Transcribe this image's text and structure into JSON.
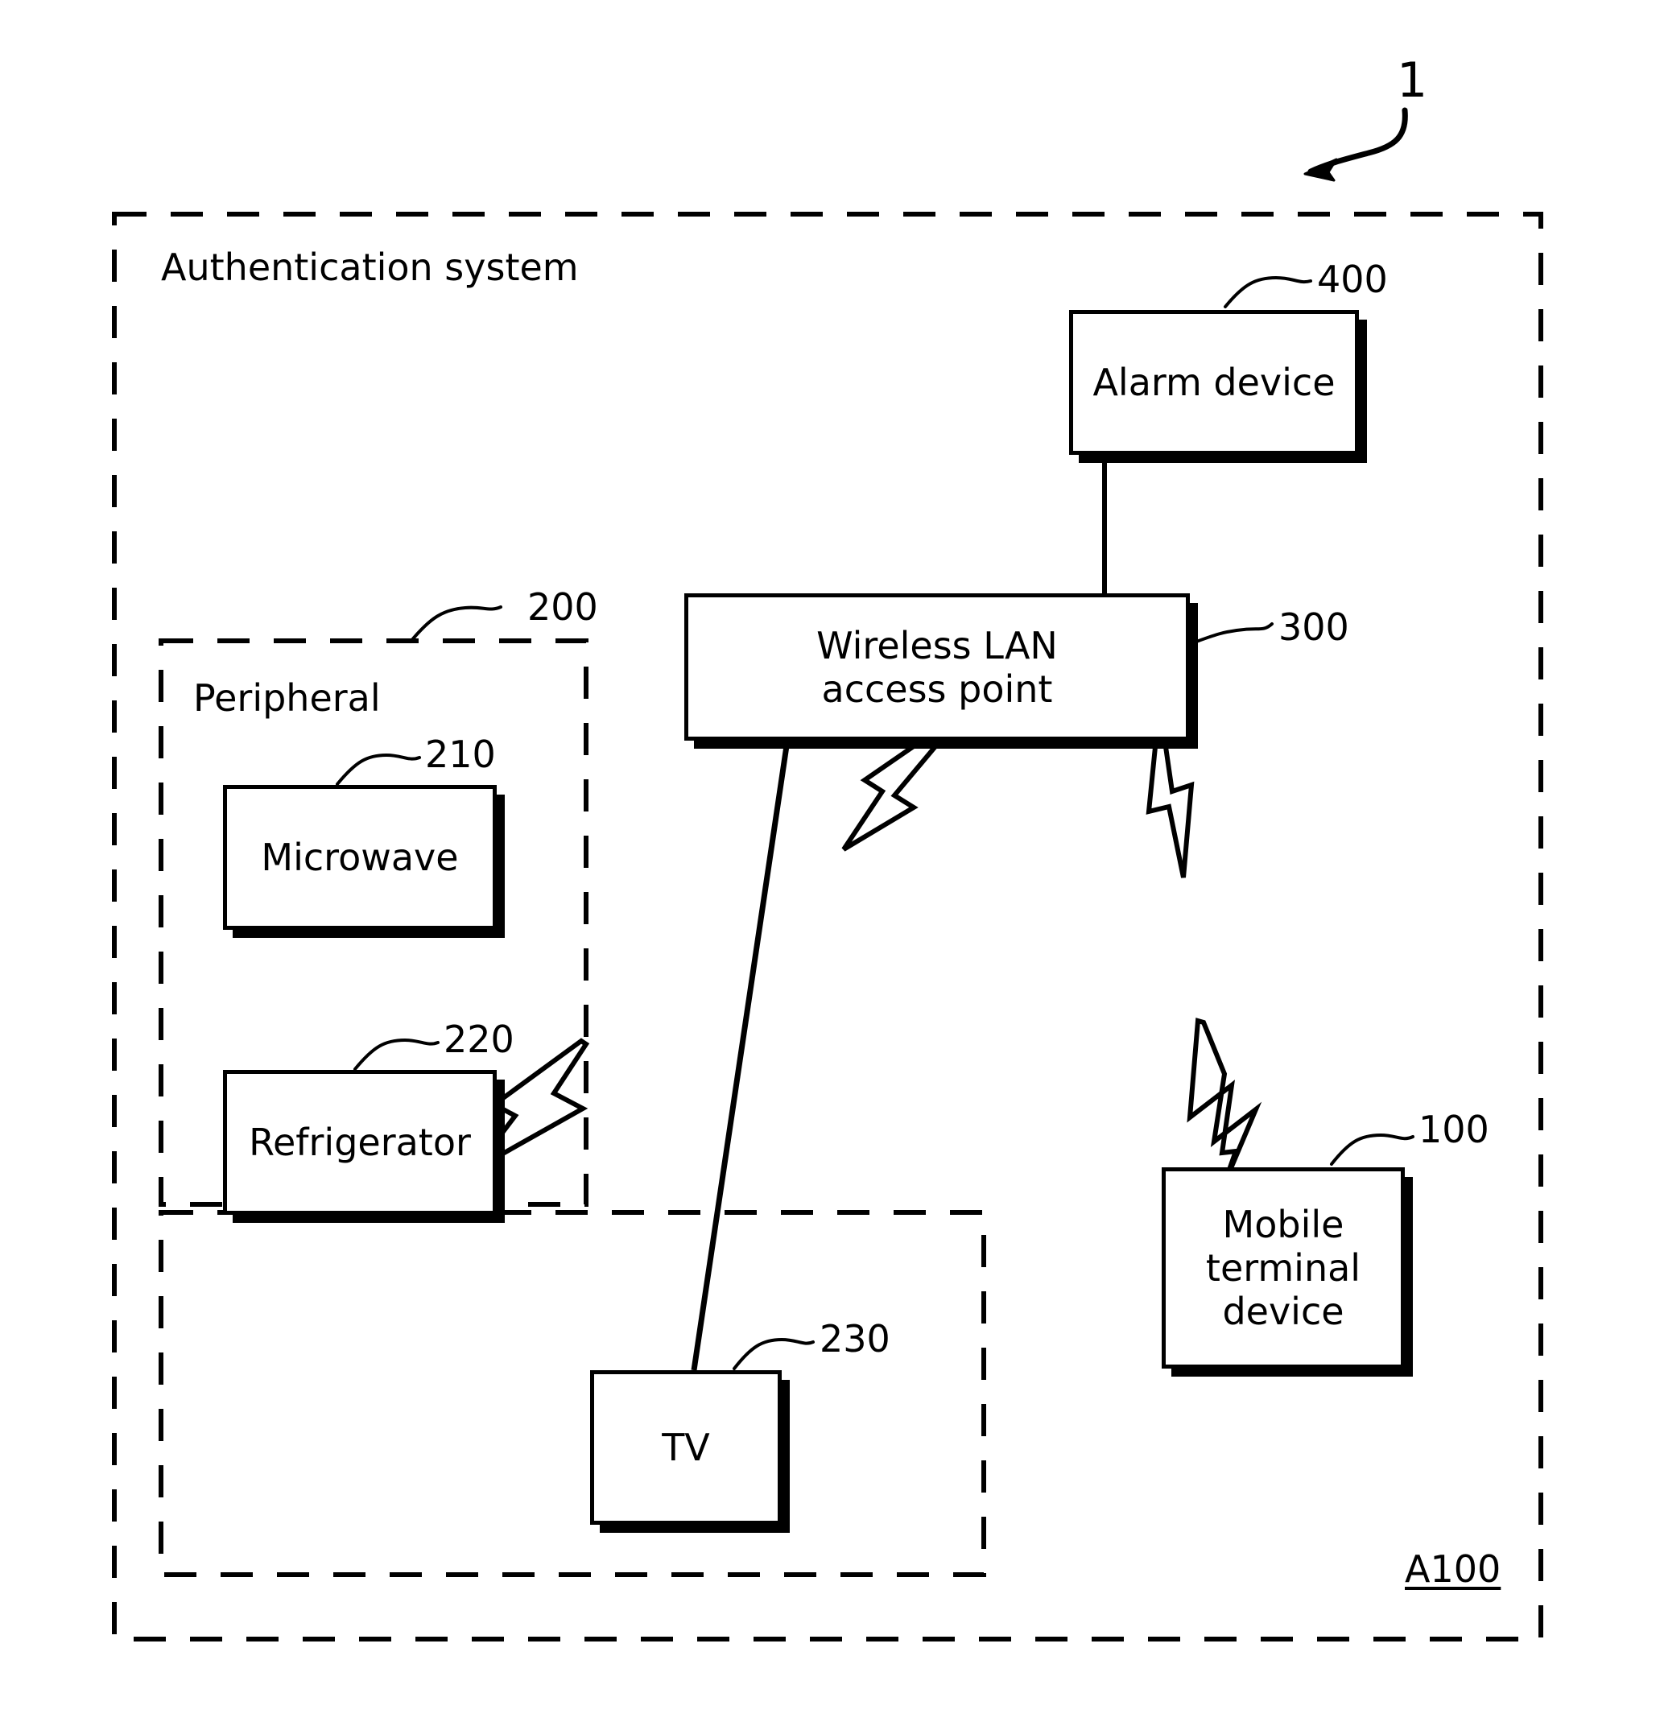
{
  "figure": {
    "figure_ref": "1",
    "system_ref": "A100",
    "outer_group_label": "Authentication system",
    "peripheral_group_label": "Peripheral",
    "peripheral_ref": "200"
  },
  "nodes": [
    {
      "id": "alarm",
      "label": "Alarm device",
      "ref": "400"
    },
    {
      "id": "ap",
      "label": "Wireless LAN\naccess point",
      "ref": "300"
    },
    {
      "id": "microwave",
      "label": "Microwave",
      "ref": "210"
    },
    {
      "id": "fridge",
      "label": "Refrigerator",
      "ref": "220"
    },
    {
      "id": "tv",
      "label": "TV",
      "ref": "230"
    },
    {
      "id": "mobile",
      "label": "Mobile\nterminal\ndevice",
      "ref": "100"
    }
  ],
  "labels": {
    "alarm_line1": "Alarm device",
    "ap_line1": "Wireless LAN",
    "ap_line2": "access point",
    "microwave_line1": "Microwave",
    "fridge_line1": "Refrigerator",
    "tv_line1": "TV",
    "mobile_line1": "Mobile",
    "mobile_line2": "terminal",
    "mobile_line3": "device"
  },
  "connections": [
    {
      "from": "alarm",
      "to": "ap",
      "type": "wired"
    },
    {
      "from": "ap",
      "to": "tv",
      "type": "wired"
    },
    {
      "from": "ap",
      "to": "fridge",
      "type": "wireless"
    },
    {
      "from": "ap",
      "to": "mobile",
      "type": "wireless"
    }
  ],
  "colors": {
    "stroke": "#000000",
    "background": "#ffffff"
  }
}
